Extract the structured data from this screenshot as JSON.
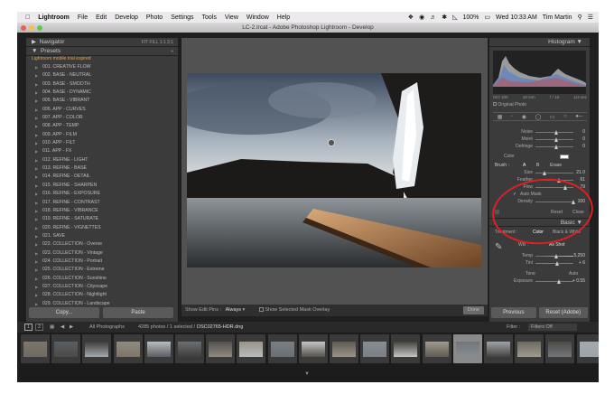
{
  "menubar": {
    "app": "Lightroom",
    "items": [
      "File",
      "Edit",
      "Develop",
      "Photo",
      "Settings",
      "Tools",
      "View",
      "Window",
      "Help"
    ],
    "battery": "100%",
    "clock": "Wed 10:33 AM",
    "user": "Tim Martin"
  },
  "titlebar": {
    "title": "LC-2.lrcat - Adobe Photoshop Lightroom - Develop"
  },
  "left_panel": {
    "navigator_label": "Navigator",
    "navigator_zoom": "FIT  FILL  1:1  3:1",
    "presets_label": "Presets",
    "trial_notice": "Lightroom mobile trial expired",
    "presets": [
      "001. CREATIVE FLOW",
      "002. BASE - NEUTRAL",
      "003. BASE - SMOOTH",
      "004. BASE - DYNAMIC",
      "005. BASE - VIBRANT",
      "006. APP - CURVES",
      "007. APP - COLOR",
      "008. APP - TEMP",
      "009. APP - FILM",
      "010. APP - FILT",
      "011. APP - FX",
      "012. REFINE - LIGHT",
      "013. REFINE - BASE",
      "014. REFINE - DETAIL",
      "015. REFINE - SHARPEN",
      "016. REFINE - EXPOSURE",
      "017. REFINE - CONTRAST",
      "018. REFINE - VIBRANCE",
      "019. REFINE - SATURATE",
      "020. REFINE - VIGNETTES",
      "021. SAVE",
      "022. COLLECTION - Overse",
      "023. COLLECTION - Vintage",
      "024. COLLECTION - Portrait",
      "025. COLLECTION - Extreme",
      "026. COLLECTION - Sunshine",
      "027. COLLECTION - Cityscape",
      "028. COLLECTION - Nightlight",
      "029. COLLECTION - Landscape"
    ],
    "copy_button": "Copy...",
    "paste_button": "Paste"
  },
  "toolbar": {
    "show_edit_pins_label": "Show Edit Pins :",
    "show_edit_pins_value": "Always",
    "mask_overlay_label": "Show Selected Mask Overlay",
    "done_button": "Done"
  },
  "right_panel": {
    "histogram_label": "Histogram",
    "exif": [
      "ISO 100",
      "16 mm",
      "f / 16",
      "1/4 sec"
    ],
    "original_photo_label": "Original Photo",
    "upper_sliders": [
      {
        "label": "Noise",
        "value": "0"
      },
      {
        "label": "Moiré",
        "value": "0"
      },
      {
        "label": "Defringe",
        "value": "0"
      }
    ],
    "color_label": "Color",
    "brush_label": "Brush :",
    "brush_options": [
      "A",
      "B",
      "Erase"
    ],
    "brush_sliders": [
      {
        "label": "Size",
        "value": "21.0"
      },
      {
        "label": "Feather",
        "value": "61"
      },
      {
        "label": "Flow",
        "value": "79"
      }
    ],
    "auto_mask_label": "Auto Mask",
    "density_label": "Density",
    "density_value": "100",
    "reset_label": "Reset",
    "close_label": "Close",
    "basic_label": "Basic",
    "treatment_label": "Treatment :",
    "treatment_color": "Color",
    "treatment_bw": "Black & White",
    "wb_label": "WB :",
    "wb_value": "As Shot",
    "temp_label": "Temp",
    "temp_value": "5,250",
    "tint_label": "Tint",
    "tint_value": "+ 6",
    "tone_label": "Tone",
    "auto_label": "Auto",
    "exposure_label": "Exposure",
    "exposure_value": "+ 0.55",
    "previous_button": "Previous",
    "reset_button": "Reset (Adobe)"
  },
  "filmstrip_bar": {
    "page1": "1",
    "page2": "2",
    "source": "All Photographs",
    "count": "4285 photos / 1 selected /",
    "filename": "DSC02765-HDR.dng",
    "filter_label": "Filter :",
    "filter_value": "Filters Off"
  },
  "colors": {
    "accent_annotation": "#e01f24",
    "panel": "#3b3b3b",
    "trial": "#e8a33a"
  }
}
